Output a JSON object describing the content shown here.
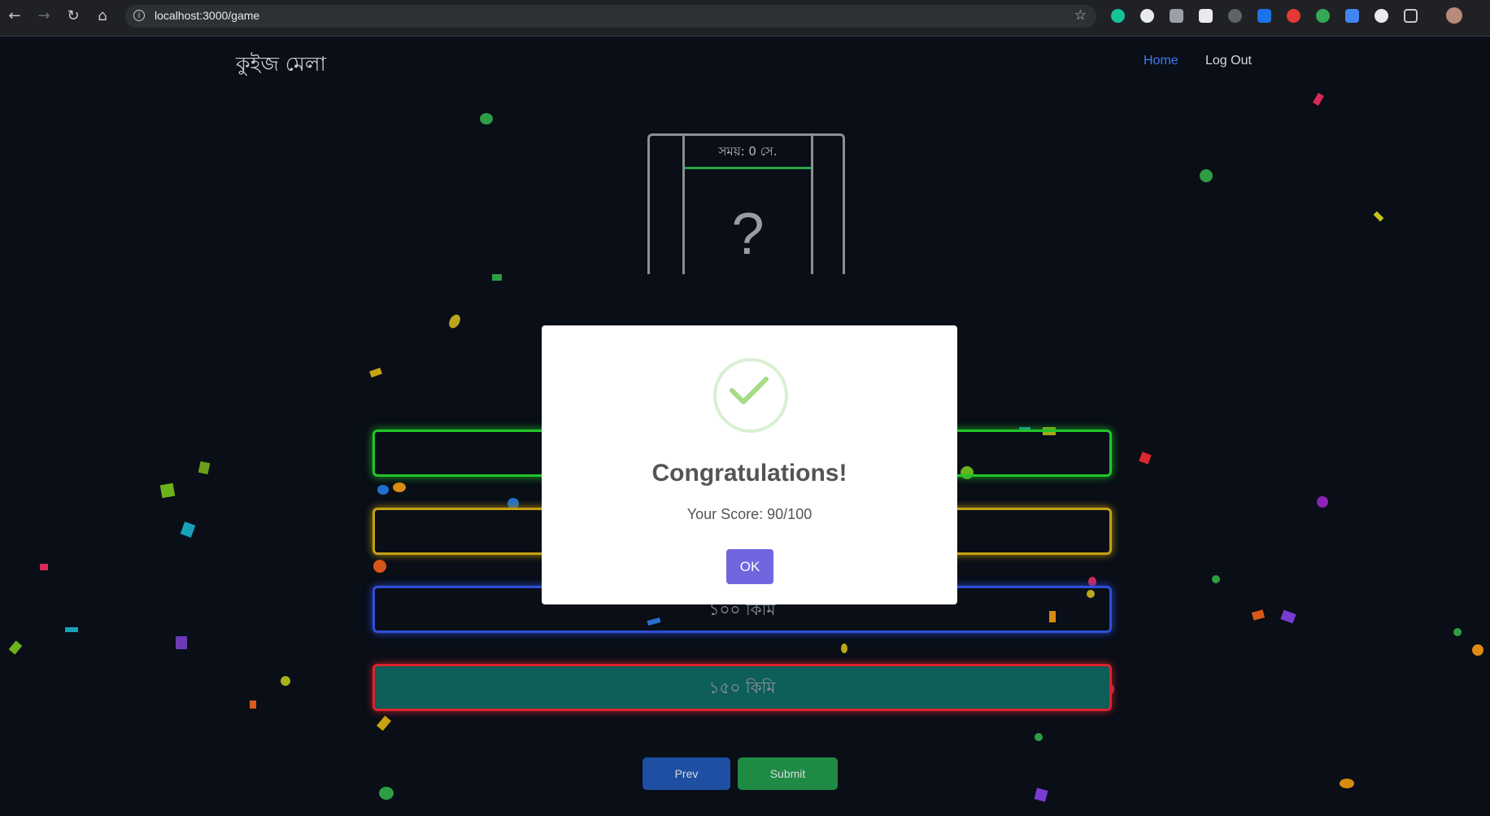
{
  "browser": {
    "url": "localhost:3000/game"
  },
  "header": {
    "brand": "কুইজ মেলা",
    "nav": [
      {
        "label": "Home",
        "color": "#3d7bf0"
      },
      {
        "label": "Log Out",
        "color": "#d6d9dd"
      }
    ]
  },
  "timer": {
    "label": "সময়: 0 সে.",
    "card_symbol": "?"
  },
  "options": [
    {
      "label": ""
    },
    {
      "label": ""
    },
    {
      "label": "১০০ কিমি"
    },
    {
      "label": "১৫০ কিমি"
    }
  ],
  "controls": {
    "prev_label": "Prev",
    "submit_label": "Submit"
  },
  "modal": {
    "title": "Congratulations!",
    "text": "Your Score: 90/100",
    "ok_label": "OK",
    "accent": "#7066e0",
    "check_color": "#a5dc86"
  }
}
